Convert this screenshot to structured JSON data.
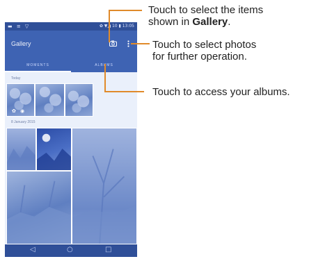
{
  "status_bar": {
    "left_icons": "▬ ≡ ▽",
    "right_text": "✿ ▼◢ 10 ▮ 13:05"
  },
  "app_bar": {
    "title": "Gallery",
    "camera_icon": "camera-icon",
    "more_icon": "overflow-menu-icon"
  },
  "tabs": [
    {
      "label": "MOMENTS"
    },
    {
      "label": "ALBUMS"
    }
  ],
  "sections": [
    {
      "label": "Today"
    },
    {
      "label": "8 January 2015"
    }
  ],
  "nav_bar": {
    "back": "◁",
    "home": "○",
    "recents": "□"
  },
  "callouts": [
    {
      "line1": "Touch to select the items",
      "line2_prefix": "shown in ",
      "line2_bold": "Gallery",
      "line2_suffix": "."
    },
    {
      "line1": "Touch to select photos",
      "line2": "for further operation."
    },
    {
      "line1": "Touch to access your albums."
    }
  ],
  "colors": {
    "app_bar": "#3e63b3",
    "status_bar": "#2f4f98",
    "callout_line": "#e08a2a",
    "background": "#eaf0fb"
  }
}
